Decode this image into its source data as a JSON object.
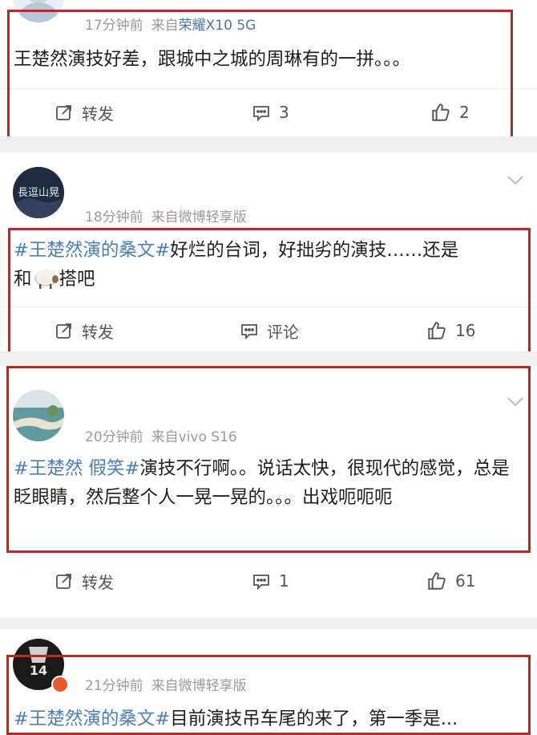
{
  "posts": [
    {
      "meta_time": "17分钟前",
      "meta_from": "来自",
      "meta_device": "荣耀X10 5G",
      "content_text": "王楚然演技好差，跟城中之城的周琳有的一拼。。。",
      "repost_label": "转发",
      "comment_count": "3",
      "like_count": "2"
    },
    {
      "meta_time": "18分钟前",
      "meta_from": "来自微博轻享版",
      "avatar_text": "長逗山晃",
      "hashtag": "#王楚然演的桑文#",
      "content_text": "好烂的台词，好拙劣的演技……还是",
      "content_text_2": "搭吧",
      "content_prefix": "和",
      "repost_label": "转发",
      "comment_label": "评论",
      "like_count": "16"
    },
    {
      "meta_time": "20分钟前",
      "meta_from": "来自vivo S16",
      "hashtag": "#王楚然 假笑#",
      "content_text": "演技不行啊。。说话太快，很现代的感觉，总是眨眼睛，然后整个人一晃一晃的。。。出戏呃呃呃",
      "repost_label": "转发",
      "comment_count": "1",
      "like_count": "61"
    },
    {
      "meta_time": "21分钟前",
      "meta_from": "来自微博轻享版",
      "avatar_text": "14",
      "hashtag": "#王楚然演的桑文#",
      "content_text": "目前演技吊车尾的来了，第一季是..."
    }
  ],
  "colors": {
    "hashtag": "#4a7fb5",
    "highlight_box": "#a8312c",
    "meta": "#9a9a9a",
    "divider": "#efefef"
  },
  "icons": [
    "repost-icon",
    "comment-icon",
    "like-icon",
    "chevron-down-icon",
    "sheep-emoji"
  ]
}
